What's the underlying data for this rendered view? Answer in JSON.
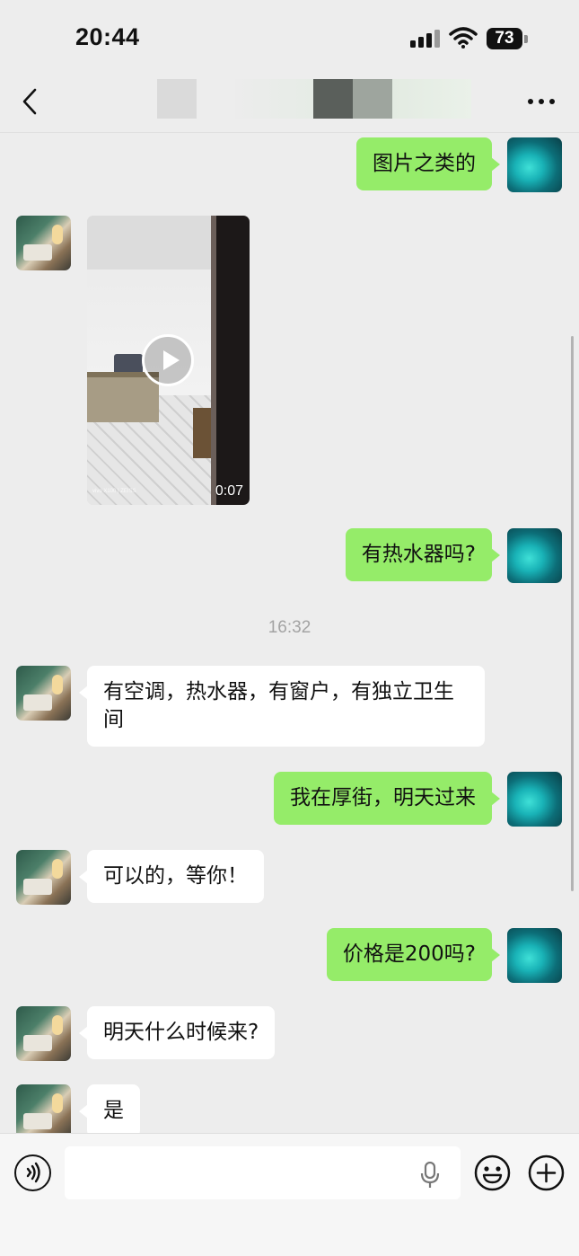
{
  "status_bar": {
    "time": "20:44",
    "battery": "73"
  },
  "header": {
    "title": ""
  },
  "messages": [
    {
      "side": "me",
      "type": "text",
      "text": "图片之类的"
    },
    {
      "side": "other",
      "type": "video",
      "duration": "0:07",
      "watermark": "vivo X100 | ZEISS"
    },
    {
      "side": "me",
      "type": "text",
      "text": "有热水器吗?"
    },
    {
      "type": "timestamp",
      "text": "16:32"
    },
    {
      "side": "other",
      "type": "text",
      "text": "有空调，热水器，有窗户，有独立卫生间"
    },
    {
      "side": "me",
      "type": "text",
      "text": "我在厚街，明天过来"
    },
    {
      "side": "other",
      "type": "text",
      "text": "可以的，等你！"
    },
    {
      "side": "me",
      "type": "text",
      "text": "价格是200吗?"
    },
    {
      "side": "other",
      "type": "text",
      "text": "明天什么时候来?"
    },
    {
      "side": "other",
      "type": "text",
      "text": "是"
    }
  ],
  "input_bar": {
    "value": "",
    "placeholder": ""
  },
  "colors": {
    "background": "#ededed",
    "my_bubble": "#95ec69",
    "other_bubble": "#ffffff",
    "timestamp": "#a3a3a3"
  },
  "icons": [
    "back-icon",
    "more-icon",
    "play-icon",
    "voice-icon",
    "mic-icon",
    "emoji-icon",
    "plus-icon"
  ]
}
